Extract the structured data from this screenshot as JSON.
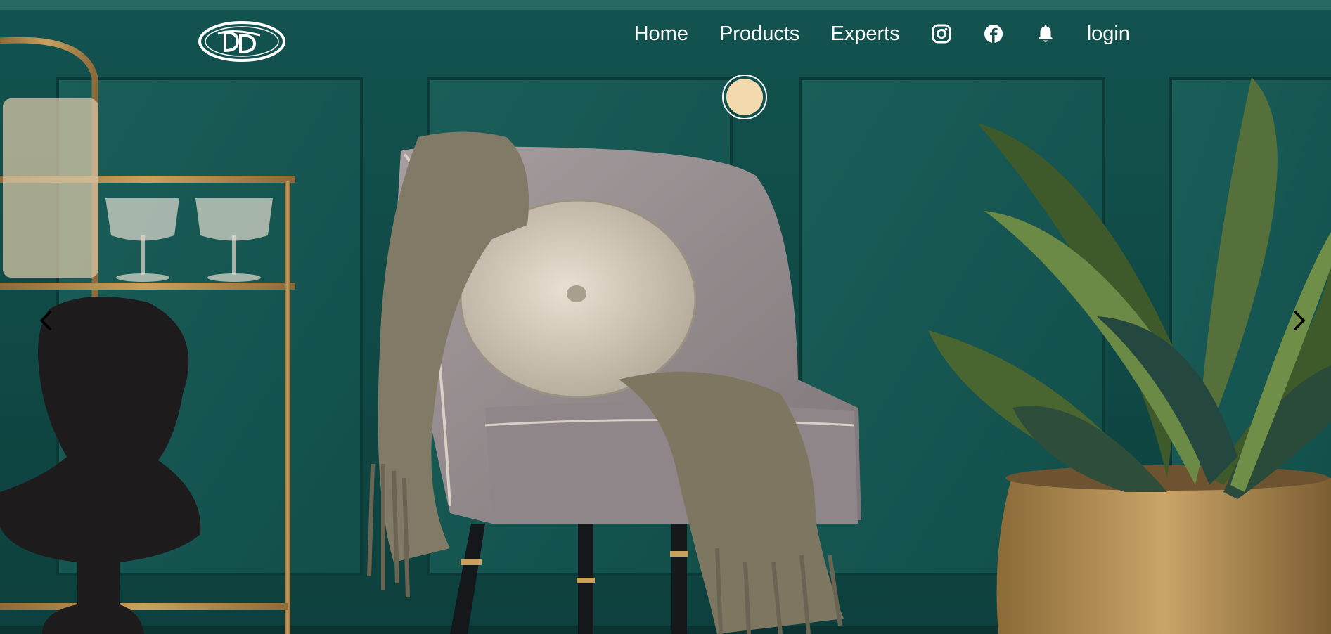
{
  "hero": {
    "image_icon": "living-room-hero-image",
    "accent_color": "#0f4a47"
  },
  "logo": {
    "icon": "dd-monogram-logo",
    "text": "DD"
  },
  "nav": {
    "items": [
      {
        "label": "Home"
      },
      {
        "label": "Products"
      },
      {
        "label": "Experts"
      }
    ],
    "icons": [
      "instagram-icon",
      "facebook-icon",
      "bell-icon"
    ],
    "login_label": "login"
  },
  "carousel": {
    "prev_icon": "chevron-left-icon",
    "next_icon": "chevron-right-icon"
  },
  "cursor_dot": {
    "color": "#f3d9ae"
  }
}
